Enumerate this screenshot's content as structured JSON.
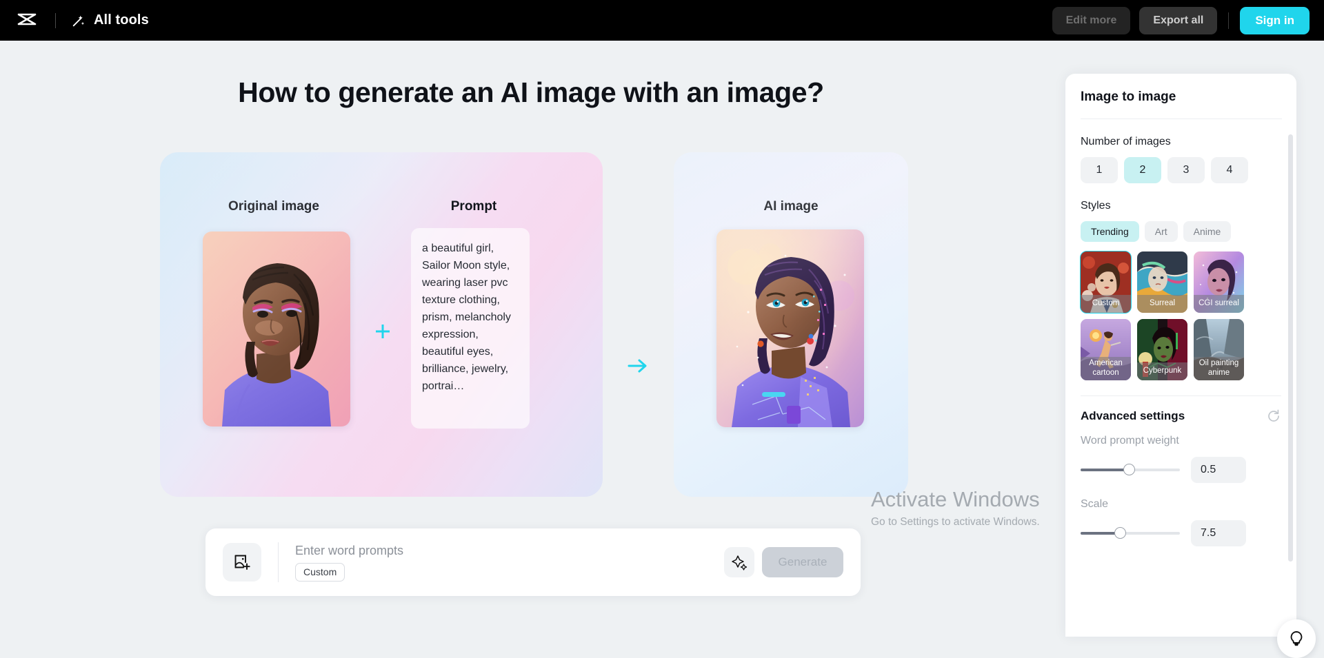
{
  "topbar": {
    "logo_icon": "capcut-logo-icon",
    "all_tools_label": "All tools",
    "wand_icon": "magic-wand-icon",
    "edit_more_label": "Edit more",
    "export_all_label": "Export all",
    "sign_in_label": "Sign in",
    "accent_color": "#20D5EC"
  },
  "main": {
    "page_title": "How to generate an AI image with an image?",
    "left_card": {
      "original_heading": "Original image",
      "prompt_heading": "Prompt",
      "prompt_text": "a beautiful girl, Sailor Moon style, wearing laser pvc texture clothing, prism, melancholy expression, beautiful eyes, brilliance, jewelry, portrai…",
      "plus_icon": "plus-icon"
    },
    "arrow_icon": "arrow-right-icon",
    "right_card": {
      "ai_heading": "AI image"
    }
  },
  "prompt_bar": {
    "upload_icon": "image-upload-icon",
    "placeholder": "Enter word prompts",
    "custom_chip_label": "Custom",
    "sparkle_icon": "sparkles-icon",
    "generate_label": "Generate"
  },
  "side_panel": {
    "title": "Image to image",
    "number_of_images": {
      "label": "Number of images",
      "options": [
        "1",
        "2",
        "3",
        "4"
      ],
      "selected": "2",
      "selected_color": "#c8f1f2"
    },
    "styles": {
      "label": "Styles",
      "tabs": [
        "Trending",
        "Art",
        "Anime"
      ],
      "active_tab": "Trending",
      "items": [
        {
          "name": "Custom",
          "selected": true
        },
        {
          "name": "Surreal",
          "selected": false
        },
        {
          "name": "CGI surreal",
          "selected": false
        },
        {
          "name": "American cartoon",
          "selected": false
        },
        {
          "name": "Cyberpunk",
          "selected": false
        },
        {
          "name": "Oil painting anime",
          "selected": false
        }
      ],
      "selection_outline_color": "#20D5EC"
    },
    "advanced": {
      "title": "Advanced settings",
      "reset_icon": "reset-icon",
      "word_prompt_weight": {
        "label": "Word prompt weight",
        "value": "0.5",
        "percent": 50
      },
      "scale": {
        "label": "Scale",
        "value": "7.5",
        "percent": 40
      }
    }
  },
  "watermark": {
    "line1": "Activate Windows",
    "line2": "Go to Settings to activate Windows."
  },
  "help": {
    "icon": "lightbulb-icon"
  }
}
